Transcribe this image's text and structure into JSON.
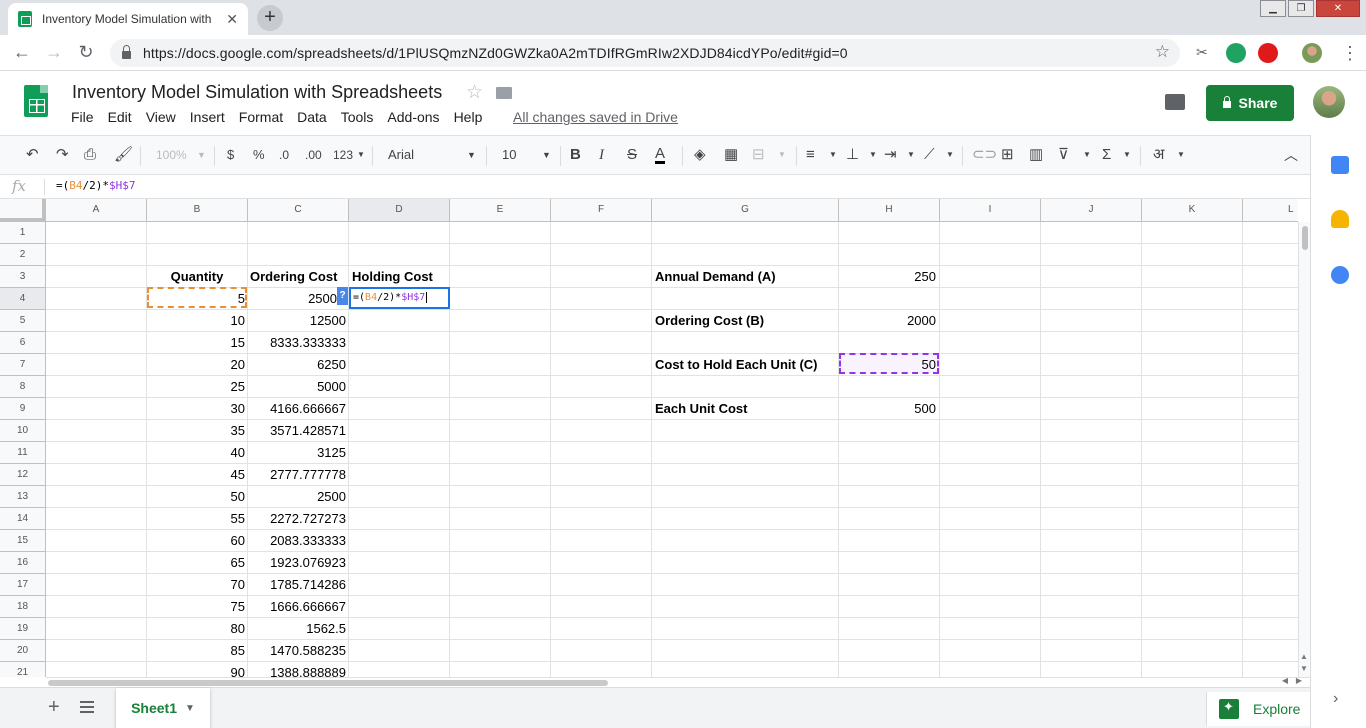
{
  "browser": {
    "tab_title": "Inventory Model Simulation with",
    "tab_close": "✕",
    "new_tab": "+",
    "url": "https://docs.google.com/spreadsheets/d/1PlUSQmzNZd0GWZka0A2mTDIfRGmRIw2XDJD84icdYPo/edit#gid=0",
    "win_minimize": "▁",
    "win_restore": "❐",
    "win_close": "✕"
  },
  "doc": {
    "title": "Inventory Model Simulation with Spreadsheets",
    "save_status": "All changes saved in Drive",
    "share_label": "Share",
    "menu": [
      "File",
      "Edit",
      "View",
      "Insert",
      "Format",
      "Data",
      "Tools",
      "Add-ons",
      "Help"
    ]
  },
  "toolbar": {
    "zoom": "100%",
    "currency": "$",
    "percent": "%",
    "dec_less": ".0",
    "dec_more": ".00",
    "more_formats": "123",
    "font": "Arial",
    "font_size": "10",
    "bold": "B",
    "italic": "I",
    "strike": "S",
    "text_color": "A",
    "input_tools": "अ"
  },
  "formula_bar": {
    "fx": "fx",
    "pre": "=(",
    "ref1": "B4",
    "mid": "/2)*",
    "ref2": "$H$7"
  },
  "grid": {
    "columns": [
      "A",
      "B",
      "C",
      "D",
      "E",
      "F",
      "G",
      "H",
      "I",
      "J",
      "K",
      "L"
    ],
    "rows": [
      "1",
      "2",
      "3",
      "4",
      "5",
      "6",
      "7",
      "8",
      "9",
      "10",
      "11",
      "12",
      "13",
      "14",
      "15",
      "16",
      "17",
      "18",
      "19",
      "20",
      "21"
    ],
    "headers": {
      "quantity": "Quantity",
      "ordering_cost": "Ordering Cost",
      "holding_cost": "Holding Cost"
    },
    "quantity": [
      "5",
      "10",
      "15",
      "20",
      "25",
      "30",
      "35",
      "40",
      "45",
      "50",
      "55",
      "60",
      "65",
      "70",
      "75",
      "80",
      "85",
      "90"
    ],
    "ordering_cost": [
      "2500",
      "12500",
      "8333.333333",
      "6250",
      "5000",
      "4166.666667",
      "3571.428571",
      "3125",
      "2777.777778",
      "2500",
      "2272.727273",
      "2083.333333",
      "1923.076923",
      "1785.714286",
      "1666.666667",
      "1562.5",
      "1470.588235",
      "1388.888889"
    ],
    "params": [
      {
        "label": "Annual Demand (A)",
        "value": "250"
      },
      {
        "label": "Ordering Cost (B)",
        "value": "2000"
      },
      {
        "label": "Cost to Hold Each Unit (C)",
        "value": "50"
      },
      {
        "label": "Each Unit Cost",
        "value": "500"
      }
    ]
  },
  "sheets": {
    "active": "Sheet1",
    "explore_label": "Explore"
  },
  "colors": {
    "green": "#188038",
    "ref_orange": "#e69138",
    "ref_purple": "#9334e6",
    "select_blue": "#1a73e8"
  }
}
